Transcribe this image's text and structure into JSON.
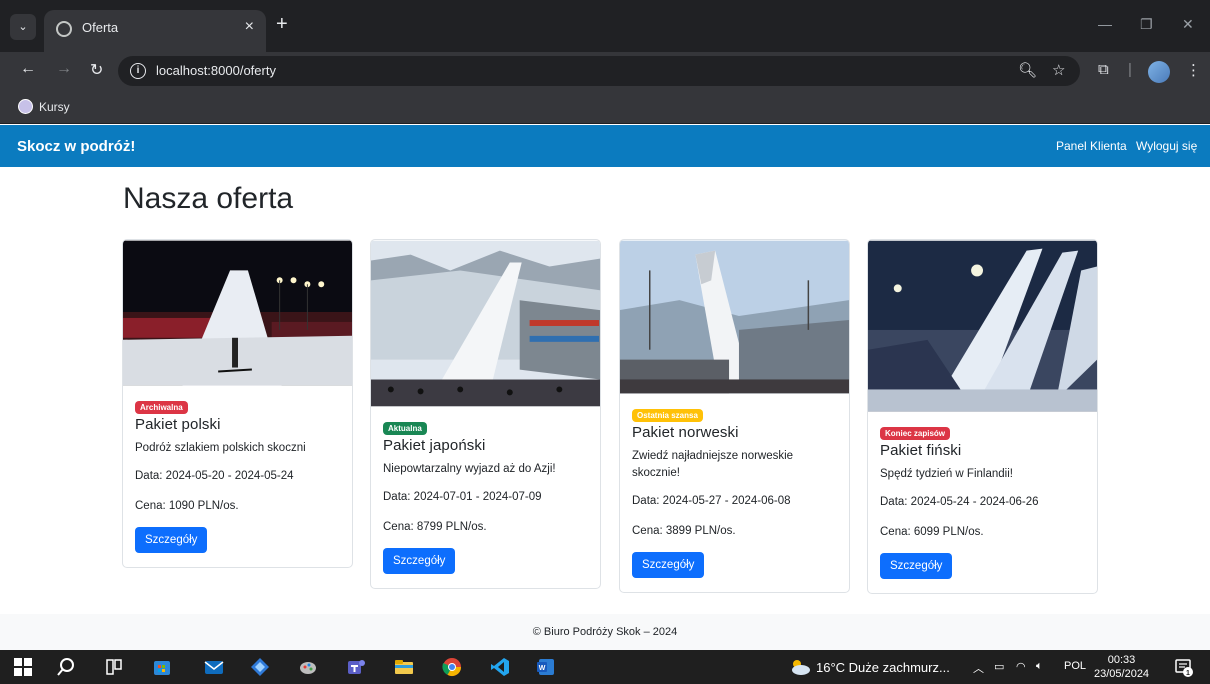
{
  "browser": {
    "tab_title": "Oferta",
    "url": "localhost:8000/oferty",
    "bookmark": "Kursy"
  },
  "site": {
    "brand": "Skocz w podróż!",
    "nav": [
      "Panel Klienta",
      "Wyloguj się"
    ],
    "title": "Nasza oferta",
    "footer": "© Biuro Podróży Skok – 2024"
  },
  "offers": [
    {
      "badge": "Archiwalna",
      "badge_color": "#dc3545",
      "title": "Pakiet polski",
      "description": "Podróż szlakiem polskich skoczni",
      "dates": "Data: 2024-05-20 - 2024-05-24",
      "price": "Cena: 1090 PLN/os.",
      "button": "Szczegóły"
    },
    {
      "badge": "Aktualna",
      "badge_color": "#198754",
      "title": "Pakiet japoński",
      "description": "Niepowtarzalny wyjazd aż do Azji!",
      "dates": "Data: 2024-07-01 - 2024-07-09",
      "price": "Cena: 8799 PLN/os.",
      "button": "Szczegóły"
    },
    {
      "badge": "Ostatnia szansa",
      "badge_color": "#ffc107",
      "title": "Pakiet norweski",
      "description": "Zwiedź najładniejsze norweskie skocznie!",
      "dates": "Data: 2024-05-27 - 2024-06-08",
      "price": "Cena: 3899 PLN/os.",
      "button": "Szczegóły"
    },
    {
      "badge": "Koniec zapisów",
      "badge_color": "#dc3545",
      "title": "Pakiet fiński",
      "description": "Spędź tydzień w Finlandii!",
      "dates": "Data: 2024-05-24 - 2024-06-26",
      "price": "Cena: 6099 PLN/os.",
      "button": "Szczegóły"
    }
  ],
  "taskbar": {
    "weather": "16°C  Duże zachmurz...",
    "language": "POL",
    "time": "00:33",
    "date": "23/05/2024",
    "notifications": "1"
  }
}
